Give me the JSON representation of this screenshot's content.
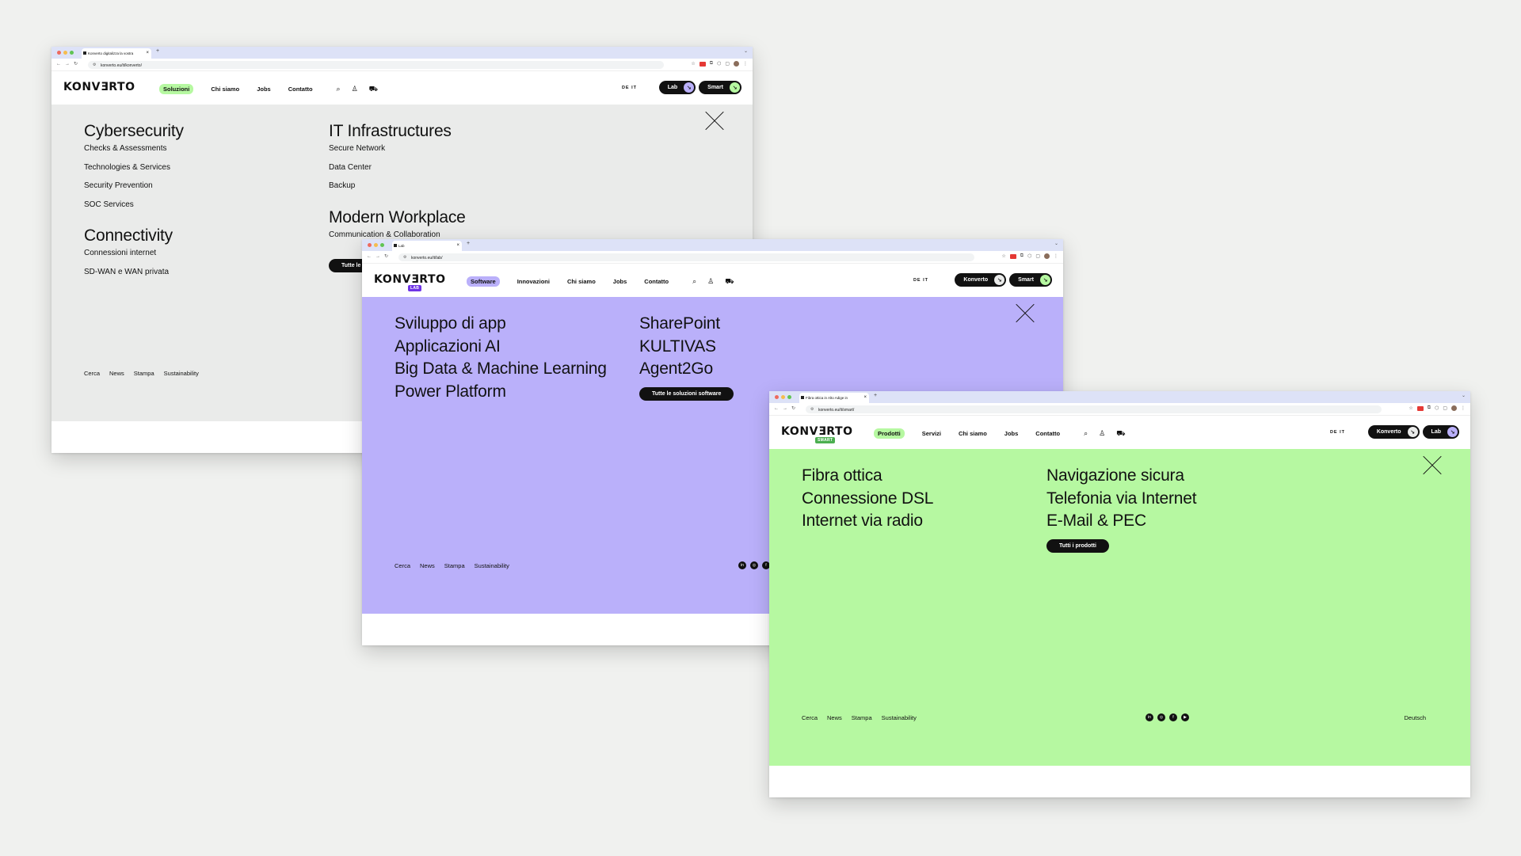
{
  "colors": {
    "konverto": "#eaebea",
    "lab": "#bab0fa",
    "smart": "#b6f8a1",
    "lab_accent": "#6f34e6",
    "smart_accent": "#4caf50"
  },
  "windows": [
    {
      "id": "konverto",
      "tab_title": "Konverto digitalizza la vostra",
      "url": "konverto.eu/it/konverto/",
      "sublogo": "",
      "nav": [
        "Soluzioni",
        "Chi siamo",
        "Jobs",
        "Contatto"
      ],
      "lang": "DE IT",
      "pills": [
        {
          "label": "Lab",
          "icon": "arrow-down-right-icon"
        },
        {
          "label": "Smart",
          "icon": "arrow-down-right-icon"
        }
      ],
      "groups_left": [
        {
          "title": "Cybersecurity",
          "items": [
            "Checks & Assessments",
            "Technologies & Services",
            "Security Prevention",
            "SOC Services"
          ]
        },
        {
          "title": "Connectivity",
          "items": [
            "Connessioni internet",
            "SD-WAN e WAN privata"
          ]
        }
      ],
      "groups_right": [
        {
          "title": "IT Infrastructures",
          "items": [
            "Secure Network",
            "Data Center",
            "Backup"
          ]
        },
        {
          "title": "Modern Workplace",
          "items": [
            "Communication & Collaboration"
          ]
        }
      ],
      "cta": "Tutte le",
      "footer": [
        "Cerca",
        "News",
        "Stampa",
        "Sustainability"
      ]
    },
    {
      "id": "lab",
      "tab_title": "Lab",
      "url": "konverto.eu/it/lab/",
      "sublogo": "LAB",
      "nav": [
        "Software",
        "Innovazioni",
        "Chi siamo",
        "Jobs",
        "Contatto"
      ],
      "lang": "DE IT",
      "pills": [
        {
          "label": "Konverto",
          "icon": "arrow-down-right-icon"
        },
        {
          "label": "Smart",
          "icon": "arrow-down-right-icon"
        }
      ],
      "left": [
        "Sviluppo di app",
        "Applicazioni AI",
        "Big Data & Machine Learning",
        "Power Platform"
      ],
      "right": [
        "SharePoint",
        "KULTIVAS",
        "Agent2Go"
      ],
      "cta": "Tutte le soluzioni software",
      "footer": [
        "Cerca",
        "News",
        "Stampa",
        "Sustainability"
      ]
    },
    {
      "id": "smart",
      "tab_title": "Fibra ottica in Alto Adige in",
      "url": "konverto.eu/it/smart/",
      "sublogo": "SMART",
      "nav": [
        "Prodotti",
        "Servizi",
        "Chi siamo",
        "Jobs",
        "Contatto"
      ],
      "lang": "DE IT",
      "pills": [
        {
          "label": "Konverto",
          "icon": "arrow-down-right-icon"
        },
        {
          "label": "Lab",
          "icon": "arrow-down-right-icon"
        }
      ],
      "left": [
        "Fibra ottica",
        "Connessione DSL",
        "Internet via radio"
      ],
      "right": [
        "Navigazione sicura",
        "Telefonia via Internet",
        "E-Mail & PEC"
      ],
      "cta": "Tutti i prodotti",
      "footer": [
        "Cerca",
        "News",
        "Stampa",
        "Sustainability"
      ],
      "footer_lang": "Deutsch"
    }
  ]
}
